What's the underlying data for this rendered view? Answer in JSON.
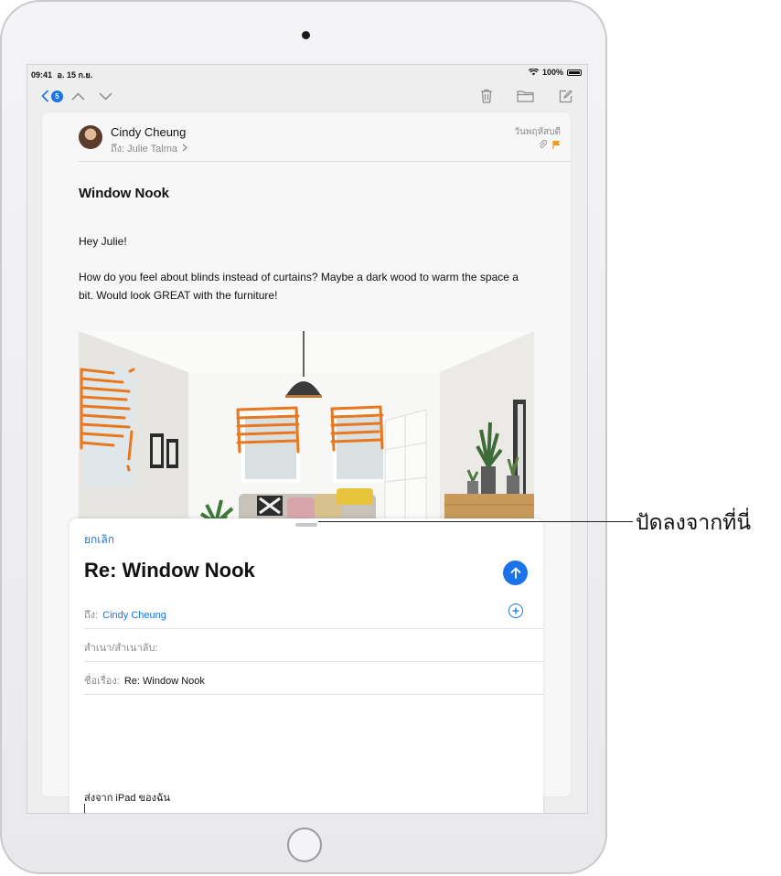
{
  "status_bar": {
    "time": "09:41",
    "date": "อ. 15 ก.ย.",
    "battery": "100%"
  },
  "toolbar": {
    "unread_count": "5"
  },
  "email": {
    "sender": "Cindy Cheung",
    "to_label": "ถึง:",
    "to_name": "Julie Talma",
    "date": "วันพฤหัสบดี",
    "subject": "Window Nook",
    "greeting": "Hey Julie!",
    "body": "How do you feel about blinds instead of curtains? Maybe a dark wood to warm the space a bit. Would look GREAT with the furniture!"
  },
  "compose": {
    "cancel": "ยกเลิก",
    "title": "Re: Window Nook",
    "to_label": "ถึง:",
    "to_value": "Cindy Cheung",
    "cc_label": "สำเนา/สำเนาลับ:",
    "subject_label": "ชื่อเรื่อง:",
    "subject_value": "Re: Window Nook",
    "signature": "ส่งจาก iPad ของฉัน"
  },
  "callout": {
    "label": "ปัดลงจากที่นี่"
  },
  "colors": {
    "accent": "#1a73e8",
    "markup": "#e8771e",
    "flag": "#f39c12"
  }
}
